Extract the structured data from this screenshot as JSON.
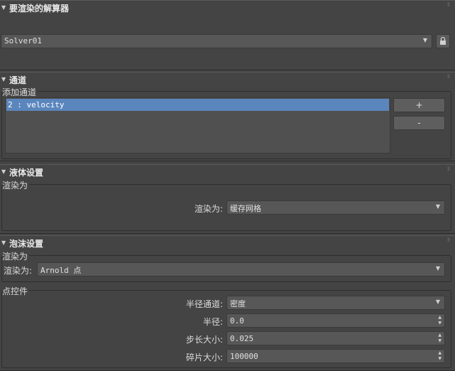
{
  "solver": {
    "title": "要渲染的解算器",
    "value": "Solver01"
  },
  "channels": {
    "title": "通道",
    "add_label": "添加通道",
    "items": [
      "2 : velocity"
    ],
    "add_button": "+",
    "remove_button": "-"
  },
  "liquid": {
    "title": "液体设置",
    "group_label": "渲染为",
    "render_as_label": "渲染为:",
    "render_as_value": "缓存网格"
  },
  "foam": {
    "title": "泡沫设置",
    "group_label": "渲染为",
    "render_as_label": "渲染为:",
    "render_as_value": "Arnold 点",
    "points_group_label": "点控件",
    "radius_channel_label": "半径通道:",
    "radius_channel_value": "密度",
    "radius_label": "半径:",
    "radius_value": "0.0",
    "step_label": "步长大小:",
    "step_value": "0.025",
    "fragment_label": "碎片大小:",
    "fragment_value": "100000"
  },
  "icons": {
    "collapse": "triangle-down-icon",
    "lock": "lock-icon",
    "grip": "grip-dots-icon",
    "dropdown": "chevron-down-icon",
    "spinner": "spinner-arrows-icon"
  },
  "colors": {
    "background": "#444444",
    "selection": "#5b86bd"
  }
}
